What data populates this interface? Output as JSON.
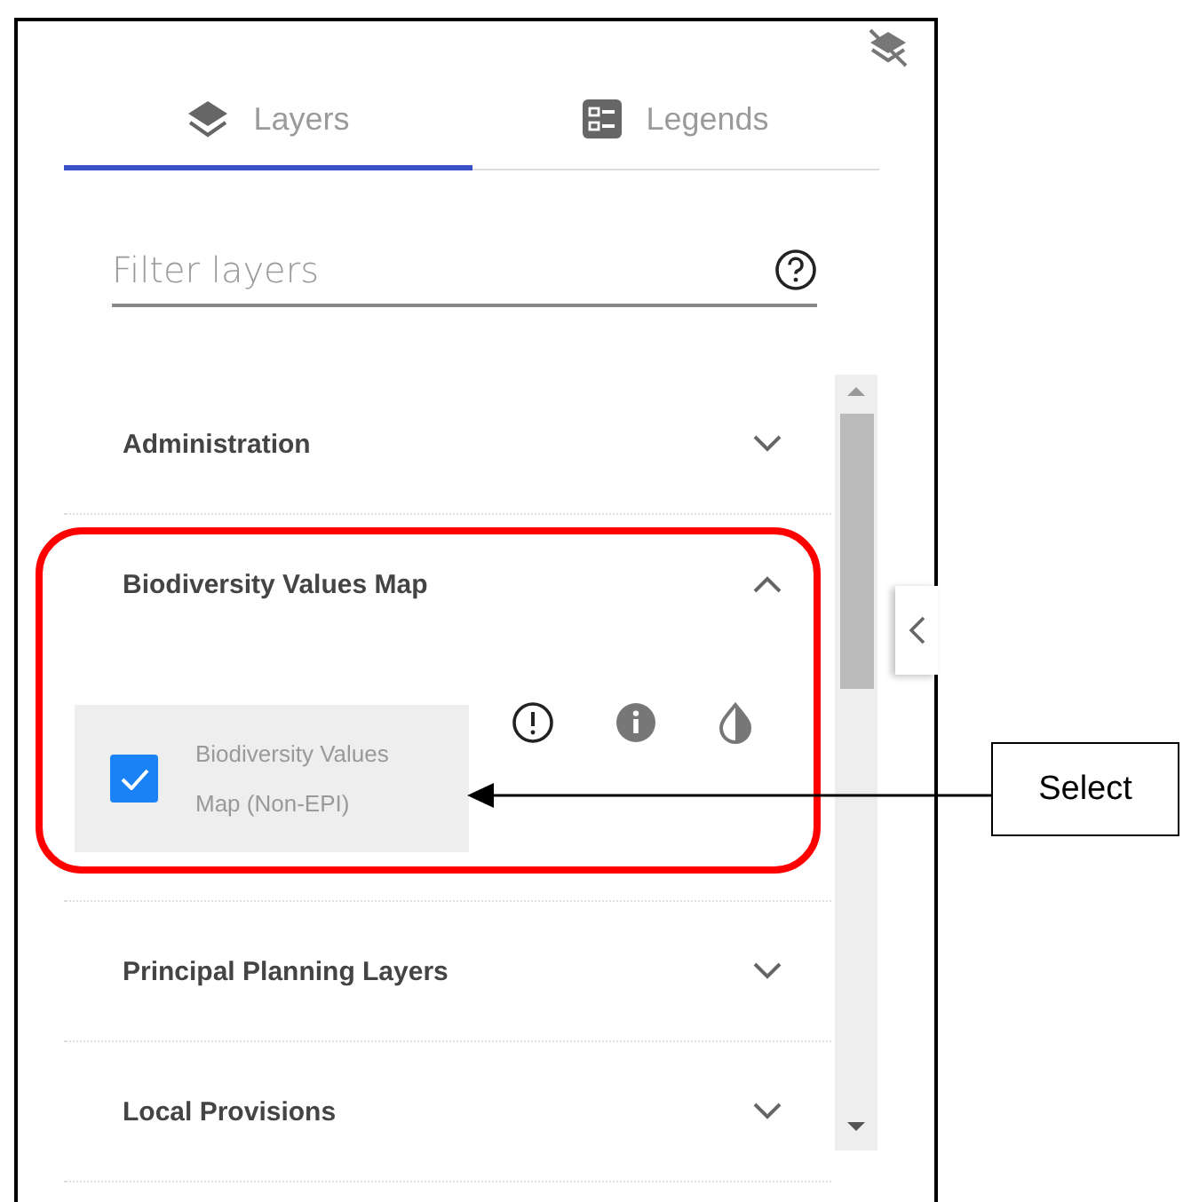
{
  "tabs": [
    {
      "label": "Layers",
      "selected": true
    },
    {
      "label": "Legends",
      "selected": false
    }
  ],
  "filter": {
    "placeholder": "Filter layers"
  },
  "groups": [
    {
      "title": "Administration",
      "expanded": false,
      "highlighted": false
    },
    {
      "title": "Biodiversity Values Map",
      "expanded": true,
      "highlighted": true,
      "layers": [
        {
          "name": "Biodiversity Values Map (Non-EPI)",
          "checked": true
        }
      ]
    },
    {
      "title": "Principal Planning Layers",
      "expanded": false,
      "highlighted": false
    },
    {
      "title": "Local Provisions",
      "expanded": false,
      "highlighted": false
    }
  ],
  "callout": {
    "label": "Select"
  }
}
